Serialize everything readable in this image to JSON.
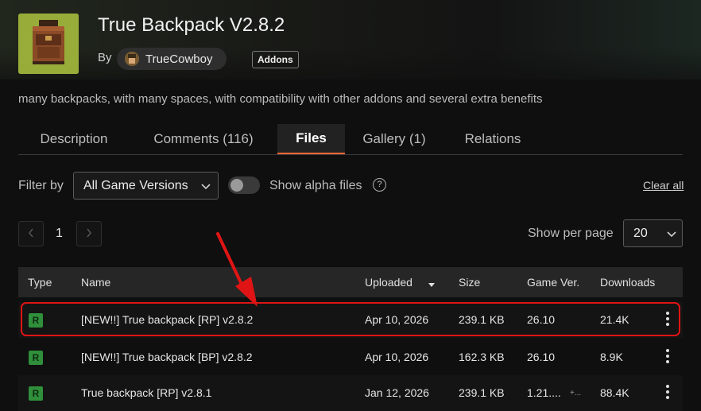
{
  "project": {
    "title": "True Backpack V2.8.2",
    "by_label": "By",
    "author": "TrueCowboy",
    "category_tag": "Addons",
    "summary": "many backpacks, with many spaces, with compatibility with other addons and several extra benefits"
  },
  "tabs": [
    {
      "label": "Description",
      "active": false
    },
    {
      "label": "Comments (116)",
      "active": false
    },
    {
      "label": "Files",
      "active": true
    },
    {
      "label": "Gallery (1)",
      "active": false
    },
    {
      "label": "Relations",
      "active": false
    }
  ],
  "filters": {
    "filter_label": "Filter by",
    "game_version": "All Game Versions",
    "alpha_label": "Show alpha files",
    "alpha_enabled": false,
    "help_icon": "question-circle-icon",
    "clear_label": "Clear all"
  },
  "pagination": {
    "current_page": "1",
    "per_page_label": "Show per page",
    "per_page_value": "20"
  },
  "table": {
    "headers": {
      "type": "Type",
      "name": "Name",
      "uploaded": "Uploaded",
      "size": "Size",
      "game_ver": "Game Ver.",
      "downloads": "Downloads"
    },
    "rows": [
      {
        "type": "R",
        "name": "[NEW!!] True backpack [RP] v2.8.2",
        "uploaded": "Apr 10, 2026",
        "size": "239.1 KB",
        "game_ver": "26.10",
        "game_ver_more": "",
        "downloads": "21.4K",
        "highlighted": true
      },
      {
        "type": "R",
        "name": "[NEW!!] True backpack [BP] v2.8.2",
        "uploaded": "Apr 10, 2026",
        "size": "162.3 KB",
        "game_ver": "26.10",
        "game_ver_more": "",
        "downloads": "8.9K",
        "highlighted": false
      },
      {
        "type": "R",
        "name": "True backpack [RP] v2.8.1",
        "uploaded": "Jan 12, 2026",
        "size": "239.1 KB",
        "game_ver": "1.21....",
        "game_ver_more": "+...",
        "downloads": "88.4K",
        "highlighted": false
      }
    ]
  },
  "colors": {
    "accent": "#f16436",
    "highlight": "#e01414",
    "release_badge": "#2f8f3b"
  }
}
